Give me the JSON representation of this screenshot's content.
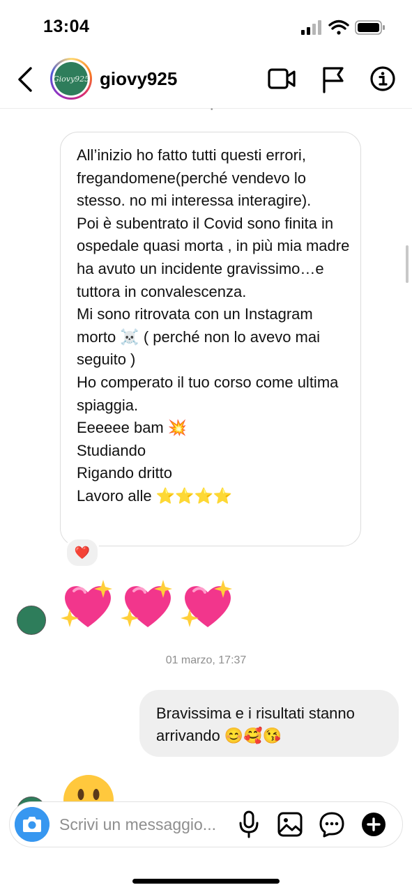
{
  "status_bar": {
    "time": "13:04",
    "icons": [
      "cellular-signal-icon",
      "wifi-icon",
      "battery-icon"
    ]
  },
  "header": {
    "username": "giovy925",
    "avatar_text": "Giovy925",
    "icons": [
      "back-arrow-icon",
      "video-call-icon",
      "flag-icon",
      "info-icon"
    ]
  },
  "messages": {
    "quoted": {
      "lines": [
        "All’inizio ho fatto tutti questi errori, fregandomene(perché vendevo lo stesso. no mi interessa interagire).",
        "Poi è subentrato il Covid sono finita in ospedale quasi morta , in più mia madre ha avuto un incidente gravissimo…e tuttora in convalescenza.",
        "Mi sono ritrovata con un Instagram morto ☠️ ( perché non lo avevo mai seguito )",
        "Ho comperato il tuo corso come ultima spiaggia.",
        "Eeeeee bam 💥",
        "Studiando",
        "Rigando dritto",
        "Lavoro alle ⭐⭐⭐⭐"
      ],
      "reaction": "❤️"
    },
    "hearts": {
      "emoji": "💖💖💖",
      "count": 3
    },
    "timestamp": "01 marzo, 17:37",
    "outgoing": {
      "text": "Bravissima e i risultati stanno arrivando 😊🥰😘"
    },
    "partial_emoji": "😶"
  },
  "composer": {
    "placeholder": "Scrivi un messaggio...",
    "icons": [
      "camera-icon",
      "microphone-icon",
      "gallery-icon",
      "sticker-icon",
      "plus-icon"
    ]
  },
  "colors": {
    "accent": "#3797f0",
    "bubble_outgoing": "#efefef",
    "avatar_green": "#2e7d5b",
    "heart_pink": "#f2368c"
  }
}
